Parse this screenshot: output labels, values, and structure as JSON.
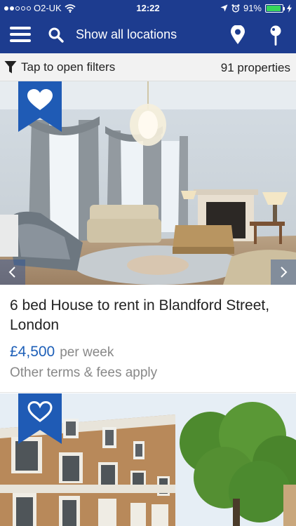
{
  "status_bar": {
    "carrier": "O2-UK",
    "time": "12:22",
    "battery_percent": "91%",
    "battery_level": 0.91,
    "signal_bars_filled": 2,
    "signal_bars_total": 5
  },
  "nav": {
    "search_label": "Show all locations",
    "icons": [
      "menu-icon",
      "search-icon",
      "location-pin-icon",
      "map-pin-icon"
    ]
  },
  "filters": {
    "label": "Tap to open filters",
    "count": "91 properties"
  },
  "listings": [
    {
      "title": "6 bed House to rent in Blandford Street, London",
      "price": "£4,500",
      "period": "per week",
      "terms": "Other terms & fees apply",
      "favorited": true
    },
    {
      "favorited": false
    }
  ],
  "colors": {
    "brand_blue": "#1d3c8f",
    "price_blue": "#1d5fb8",
    "battery_green": "#37d65a"
  }
}
